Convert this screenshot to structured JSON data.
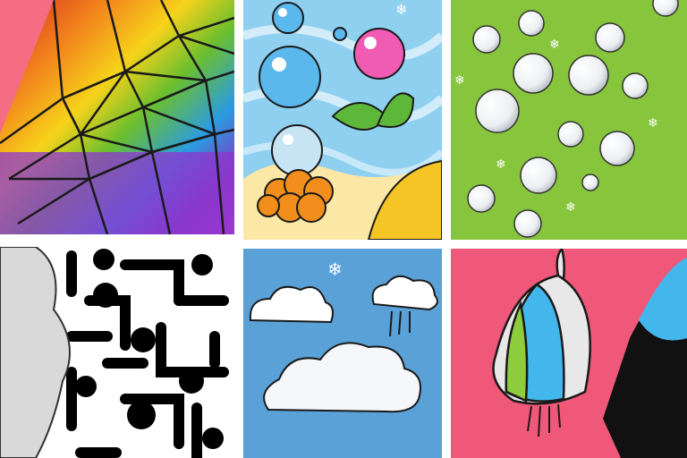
{
  "collage": {
    "panels": [
      {
        "name": "stained-glass-rainbow",
        "background": "#f56d83",
        "colors": [
          "#d32a1e",
          "#f2811c",
          "#f7d21a",
          "#6bbf2e",
          "#2b9be0",
          "#7a3fc4",
          "#c13fd0"
        ]
      },
      {
        "name": "bubbles-and-leaves",
        "background": "#8fd0f0",
        "colors": [
          "#5ab8ec",
          "#f05bb4",
          "#5db83a",
          "#f28e1b",
          "#f5c526"
        ]
      },
      {
        "name": "pearls-on-green",
        "background": "#86c53c",
        "colors": [
          "#ffffff",
          "#dfe3e8"
        ]
      },
      {
        "name": "maze-pattern",
        "background": "#ffffff",
        "colors": [
          "#000000",
          "#d9d9d9"
        ]
      },
      {
        "name": "clouds-on-blue",
        "background": "#5aa1d8",
        "colors": [
          "#ffffff",
          "#dce8f2"
        ]
      },
      {
        "name": "striped-balloon",
        "background": "#f0587a",
        "colors": [
          "#43b7ec",
          "#8ccc3d",
          "#e8e8e8",
          "#111111"
        ]
      }
    ]
  }
}
